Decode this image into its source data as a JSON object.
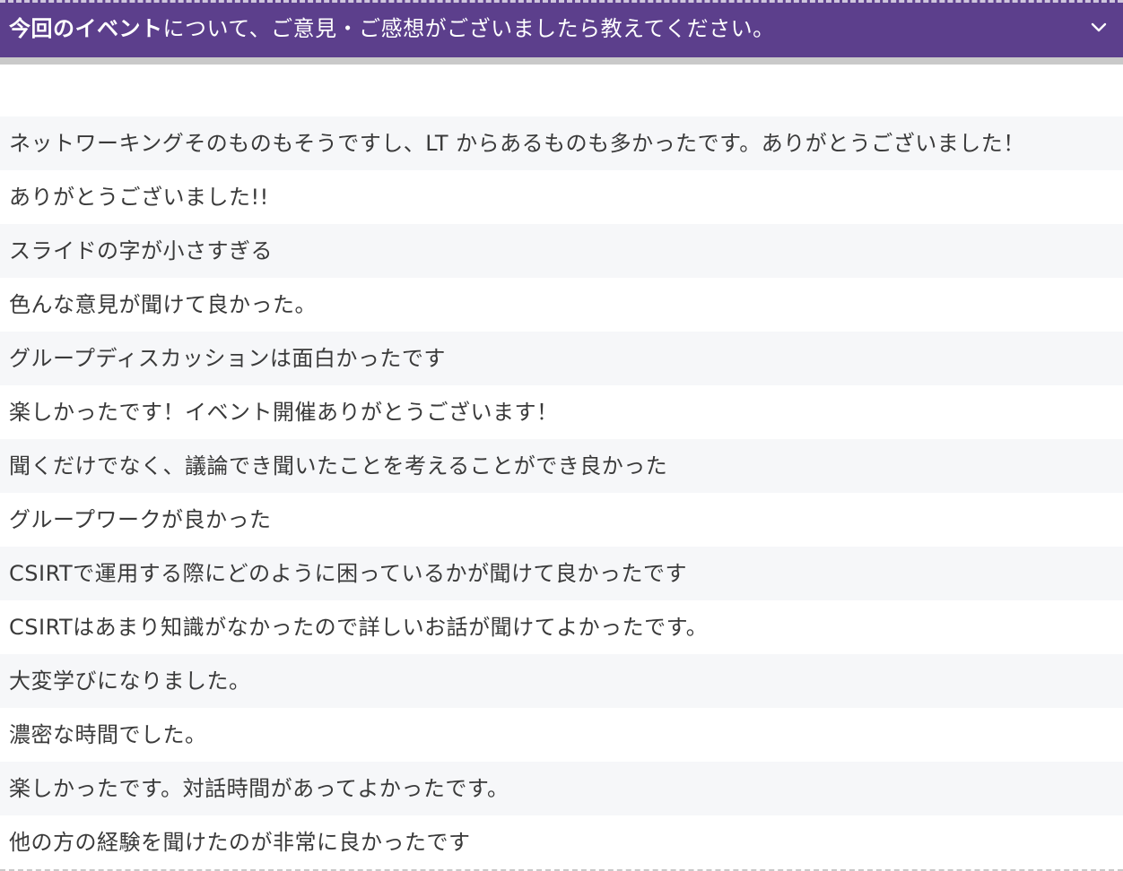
{
  "header": {
    "question_bold": "今回のイベント",
    "question_rest": "について、ご意見・ご感想がございましたら教えてください。",
    "toggle_icon": "chevron-down-icon"
  },
  "responses": [
    "ネットワーキングそのものもそうですし、LT からあるものも多かったです。ありがとうございました！",
    "ありがとうございました!!",
    "スライドの字が小さすぎる",
    "色んな意見が聞けて良かった。",
    "グループディスカッションは面白かったです",
    "楽しかったです！イベント開催ありがとうございます！",
    "聞くだけでなく、議論でき聞いたことを考えることができ良かった",
    "グループワークが良かった",
    "CSIRTで運用する際にどのように困っているかが聞けて良かったです",
    "CSIRTはあまり知識がなかったので詳しいお話が聞けてよかったです。",
    "大変学びになりました。",
    "濃密な時間でした。",
    "楽しかったです。対話時間があってよかったです。",
    "他の方の経験を聞けたのが非常に良かったです"
  ],
  "colors": {
    "header_bg": "#5c3f8c",
    "header_text": "#ffffff",
    "row_alt_bg": "#f6f7f9",
    "row_text": "#3a3a3a"
  }
}
